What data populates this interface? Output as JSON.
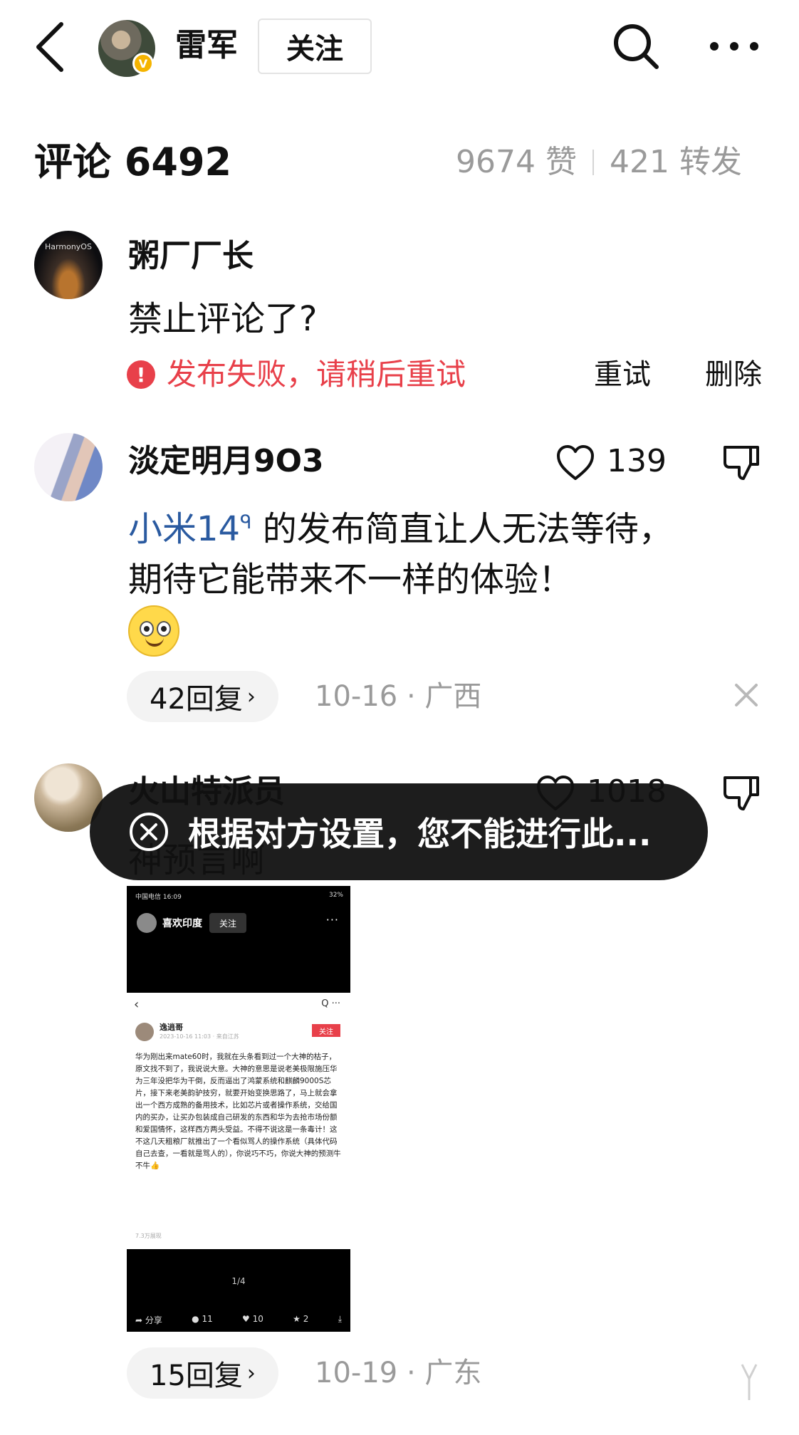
{
  "header": {
    "user_name": "雷军",
    "follow_label": "关注",
    "avatar_badge": "V",
    "icons": [
      "back-icon",
      "search-icon",
      "more-icon"
    ]
  },
  "stats": {
    "comments_title": "评论 6492",
    "likes": "9674 赞",
    "reposts": "421 转发"
  },
  "comments": [
    {
      "user": "粥厂厂长",
      "avatar_label": "HarmonyOS",
      "text": "禁止评论了?",
      "error_icon": "!",
      "error": "发布失败，请稍后重试",
      "retry_label": "重试",
      "delete_label": "删除"
    },
    {
      "user": "淡定明月9O3",
      "likes": "139",
      "text_link": "小米14",
      "text_link_icon": "ᑫ",
      "text_line1": " 的发布简直让人无法等待，",
      "text_line2": "期待它能带来不一样的体验！",
      "emoji": "smiley-emoji",
      "replies": "42回复",
      "reply_chevron": "›",
      "meta": "10-16 · 广西"
    },
    {
      "user": "火山特派员",
      "likes": "1018",
      "text": "神预言啊",
      "replies": "15回复",
      "reply_chevron": "›",
      "meta": "10-19 · 广东",
      "image": {
        "status_left": "中国电信 16:09",
        "status_right": "32%",
        "header_name": "喜欢印度",
        "header_follow": "关注",
        "header_more": "···",
        "page_back": "‹",
        "page_icons": "Q  ···",
        "post_author": "逸逍哥",
        "post_date": "2023-10-16 11:03 · 来自江苏",
        "post_follow": "关注",
        "post_body": "华为刚出来mate60时，我就在头条看到过一个大神的枯子，原文找不到了，我说说大意。大神的意思是说老美极限施压华为三年没把华为干倒，反而逼出了鸿蒙系统和麒麟9000S芯片，接下来老美韵驴技穷，就要开始变换思路了，马上就会拿出一个西方成熟的备用技术，比如芯片或者操作系统，交给国内的买办，让买办包装成自己研发的东西和华为去抢市场份额和爱国情怀，这样西方两头受益。不得不说这是一条毒计！这不这几天粗粮厂就推出了一个看似骂人的操作系统（具体代码自己去查，一看就是骂人的），你说巧不巧，你说大神的预测牛不牛👍",
        "post_views": "7.3万展现",
        "counter": "1/4",
        "action_share": "➦ 分享",
        "action_comments": "● 11",
        "action_likes": "♥ 10",
        "action_fav": "★ 2",
        "action_download": "⤓"
      }
    }
  ],
  "toast": {
    "text": "根据对方设置，您不能进行此..."
  },
  "colors": {
    "error": "#e8404a",
    "link": "#2a5aa0",
    "muted": "#9a9a9a",
    "toast_bg": "#111111"
  }
}
